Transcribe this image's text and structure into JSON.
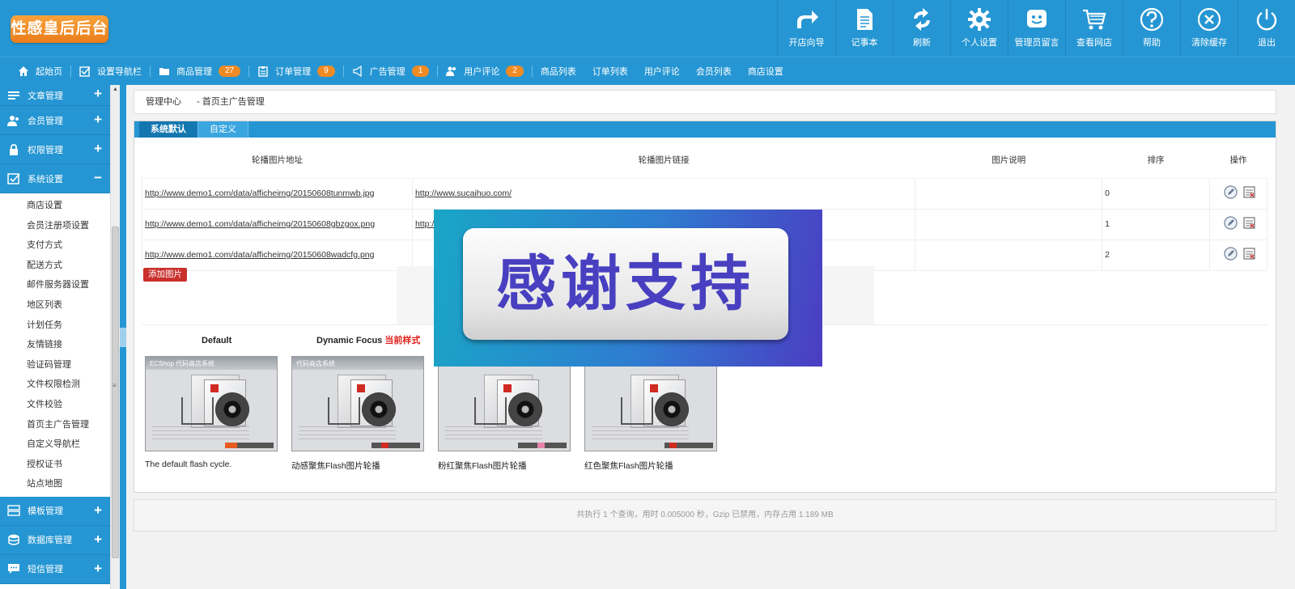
{
  "header": {
    "logo": "性感皇后后台",
    "tools": [
      {
        "label": "开店向导",
        "icon": "redo-arrow-icon"
      },
      {
        "label": "记事本",
        "icon": "notepad-icon"
      },
      {
        "label": "刷新",
        "icon": "refresh-icon"
      },
      {
        "label": "个人设置",
        "icon": "gear-icon"
      },
      {
        "label": "管理员留言",
        "icon": "message-smile-icon"
      },
      {
        "label": "查看网店",
        "icon": "shopping-cart-icon"
      },
      {
        "label": "帮助",
        "icon": "help-icon"
      },
      {
        "label": "清除缓存",
        "icon": "clear-icon"
      },
      {
        "label": "退出",
        "icon": "power-icon"
      }
    ]
  },
  "nav": {
    "items": [
      {
        "label": "起始页",
        "icon": "home-icon"
      },
      {
        "label": "设置导航栏",
        "icon": "checkbox-icon"
      },
      {
        "label": "商品管理",
        "icon": "folder-icon",
        "badge": "27"
      },
      {
        "label": "订单管理",
        "icon": "clipboard-icon",
        "badge": "9"
      },
      {
        "label": "广告管理",
        "icon": "megaphone-icon",
        "badge": "1"
      },
      {
        "label": "用户评论",
        "icon": "users-icon",
        "badge": "2"
      }
    ],
    "links": [
      "商品列表",
      "订单列表",
      "用户评论",
      "会员列表",
      "商店设置"
    ]
  },
  "sidebar": {
    "groups_top": [
      {
        "label": "文章管理",
        "icon": "list-icon",
        "toggle": "+"
      },
      {
        "label": "会员管理",
        "icon": "users-icon",
        "toggle": "+"
      },
      {
        "label": "权限管理",
        "icon": "lock-icon",
        "toggle": "+"
      },
      {
        "label": "系统设置",
        "icon": "settings-check-icon",
        "toggle": "−"
      }
    ],
    "items": [
      "商店设置",
      "会员注册项设置",
      "支付方式",
      "配送方式",
      "邮件服务器设置",
      "地区列表",
      "计划任务",
      "友情链接",
      "验证码管理",
      "文件权限检测",
      "文件校验",
      "首页主广告管理",
      "自定义导航栏",
      "授权证书",
      "站点地图"
    ],
    "groups_bottom": [
      {
        "label": "模板管理",
        "icon": "template-icon",
        "toggle": "+"
      },
      {
        "label": "数据库管理",
        "icon": "database-icon",
        "toggle": "+"
      },
      {
        "label": "短信管理",
        "icon": "sms-icon",
        "toggle": "+"
      }
    ]
  },
  "breadcrumb": {
    "root": "管理中心",
    "current": "- 首页主广告管理"
  },
  "tabs": [
    "系统默认",
    "自定义"
  ],
  "table": {
    "headers": [
      "轮播图片地址",
      "轮播图片链接",
      "图片说明",
      "排序",
      "操作"
    ],
    "rows": [
      {
        "src": "http://www.demo1.com/data/afficheimg/20150608tunmwb.jpg",
        "link": "http://www.sucaihuo.com/",
        "desc": "",
        "order": "0"
      },
      {
        "src": "http://www.demo1.com/data/afficheimg/20150608gbzgox.png",
        "link": "http://",
        "desc": "",
        "order": "1"
      },
      {
        "src": "http://www.demo1.com/data/afficheimg/20150608wadcfg.png",
        "link": "",
        "desc": "",
        "order": "2"
      }
    ]
  },
  "add_button": "添加图片",
  "styles": [
    {
      "title": "Default",
      "current": "",
      "thumb_title": "ECShop 代码商店系统",
      "desc": "The default flash cycle."
    },
    {
      "title": "Dynamic Focus",
      "current": "当前样式",
      "thumb_title": "代码商店系统",
      "desc": "动感聚焦Flash图片轮播"
    },
    {
      "title": "",
      "current": "",
      "thumb_title": "",
      "desc": "粉红聚焦Flash图片轮播"
    },
    {
      "title": "",
      "current": "",
      "thumb_title": "",
      "desc": "红色聚焦Flash图片轮播"
    }
  ],
  "footer": "共执行 1 个查询，用时 0.005000 秒，Gzip 已禁用，内存占用 1.189 MB",
  "watermark": "感谢支持",
  "colors": {
    "primary": "#2596d3",
    "badge": "#f08a24",
    "danger": "#c9302c",
    "watermark_text": "#4840c0"
  }
}
